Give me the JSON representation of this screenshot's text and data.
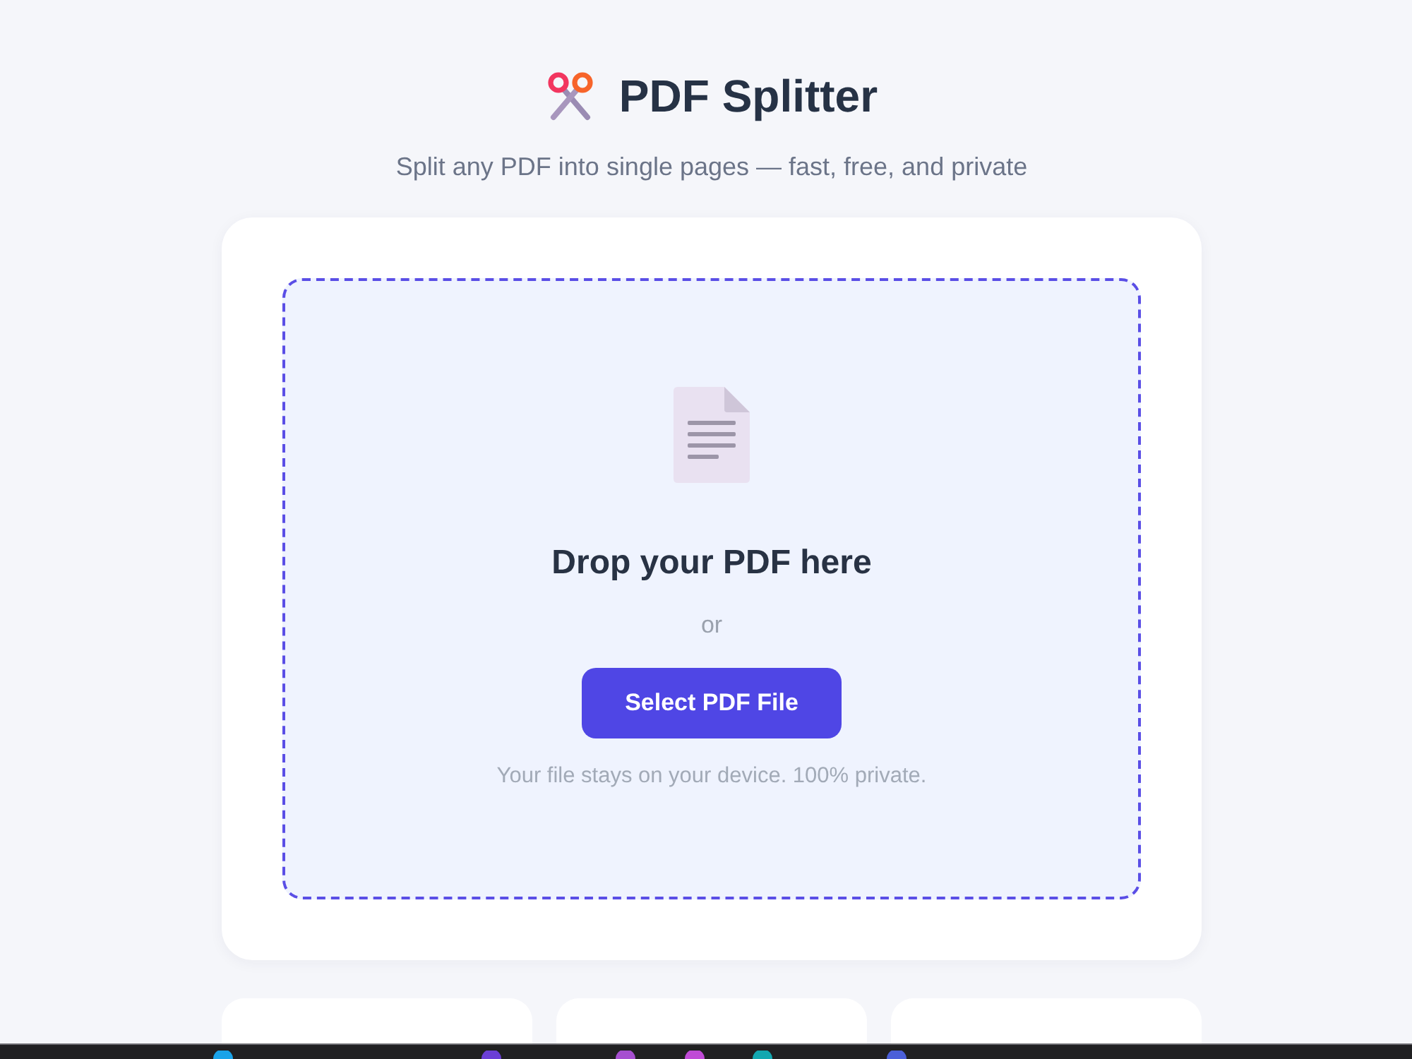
{
  "header": {
    "title": "PDF Splitter",
    "subtitle": "Split any PDF into single pages — fast, free, and private"
  },
  "dropzone": {
    "heading": "Drop your PDF here",
    "separator": "or",
    "button": "Select PDF File",
    "note": "Your file stays on your device. 100% private."
  }
}
